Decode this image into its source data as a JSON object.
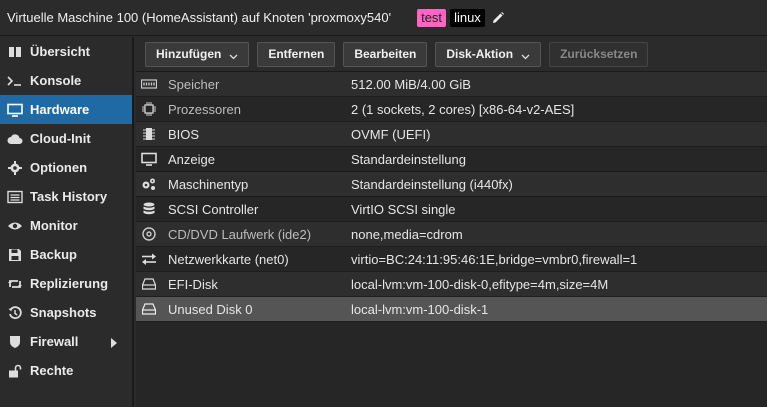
{
  "header": {
    "title": "Virtuelle Maschine 100 (HomeAssistant) auf Knoten 'proxmoxy540'",
    "tags": [
      "test",
      "linux"
    ]
  },
  "sidebar": {
    "items": [
      {
        "label": "Übersicht",
        "icon": "book-icon"
      },
      {
        "label": "Konsole",
        "icon": "terminal-icon"
      },
      {
        "label": "Hardware",
        "icon": "monitor-icon",
        "active": true
      },
      {
        "label": "Cloud-Init",
        "icon": "cloud-icon"
      },
      {
        "label": "Optionen",
        "icon": "gear-icon"
      },
      {
        "label": "Task History",
        "icon": "list-icon"
      },
      {
        "label": "Monitor",
        "icon": "eye-icon"
      },
      {
        "label": "Backup",
        "icon": "floppy-icon"
      },
      {
        "label": "Replizierung",
        "icon": "retweet-icon"
      },
      {
        "label": "Snapshots",
        "icon": "history-icon"
      },
      {
        "label": "Firewall",
        "icon": "shield-icon"
      },
      {
        "label": "Rechte",
        "icon": "unlock-icon"
      }
    ]
  },
  "toolbar": {
    "add_label": "Hinzufügen",
    "remove_label": "Entfernen",
    "edit_label": "Bearbeiten",
    "disk_action_label": "Disk-Aktion",
    "revert_label": "Zurücksetzen"
  },
  "hardware": {
    "rows": [
      {
        "name": "Speicher",
        "value": "512.00 MiB/4.00 GiB",
        "icon": "memory-icon"
      },
      {
        "name": "Prozessoren",
        "value": "2 (1 sockets, 2 cores) [x86-64-v2-AES]",
        "icon": "cpu-icon"
      },
      {
        "name": "BIOS",
        "value": "OVMF (UEFI)",
        "icon": "chip-icon"
      },
      {
        "name": "Anzeige",
        "value": "Standardeinstellung",
        "icon": "display-icon"
      },
      {
        "name": "Maschinentyp",
        "value": "Standardeinstellung (i440fx)",
        "icon": "cogs-icon"
      },
      {
        "name": "SCSI Controller",
        "value": "VirtIO SCSI single",
        "icon": "database-icon"
      },
      {
        "name": "CD/DVD Laufwerk (ide2)",
        "value": "none,media=cdrom",
        "icon": "cdrom-icon"
      },
      {
        "name": "Netzwerkkarte (net0)",
        "value": "virtio=BC:24:11:95:46:1E,bridge=vmbr0,firewall=1",
        "icon": "exchange-icon"
      },
      {
        "name": "EFI-Disk",
        "value": "local-lvm:vm-100-disk-0,efitype=4m,size=4M",
        "icon": "hdd-icon"
      },
      {
        "name": "Unused Disk 0",
        "value": "local-lvm:vm-100-disk-1",
        "icon": "hdd-icon",
        "selected": true
      }
    ]
  }
}
